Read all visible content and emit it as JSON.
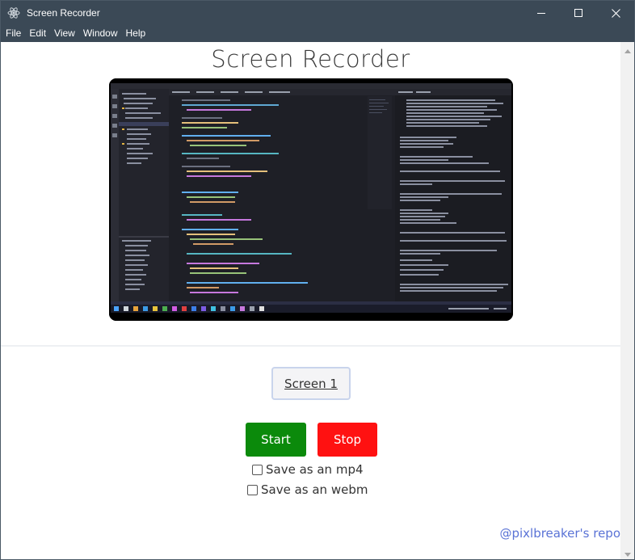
{
  "window": {
    "title": "Screen Recorder"
  },
  "menu": [
    "File",
    "Edit",
    "View",
    "Window",
    "Help"
  ],
  "app": {
    "heading": "Screen Recorder",
    "source_button": "Screen 1",
    "start_label": "Start",
    "stop_label": "Stop",
    "options": [
      {
        "label": "Save as an mp4",
        "checked": false
      },
      {
        "label": "Save as an webm",
        "checked": false
      }
    ],
    "footer_link": "@pixlbreaker's repo"
  },
  "colors": {
    "titlebar": "#3b4956",
    "start": "#0b8a0b",
    "stop": "#ff1111",
    "link": "#5a73d6"
  },
  "icons": {
    "app": "electron-atom-icon",
    "minimize": "minimize-icon",
    "maximize": "maximize-icon",
    "close": "close-icon"
  }
}
